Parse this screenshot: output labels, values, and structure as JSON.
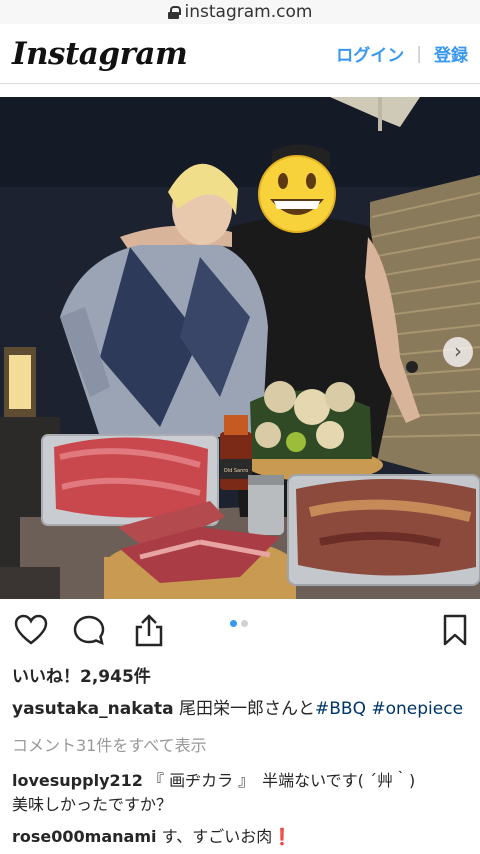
{
  "browser": {
    "url": "instagram.com"
  },
  "header": {
    "logo": "Instagram",
    "login": "ログイン",
    "signup": "登録"
  },
  "post": {
    "likes": "いいね！2,945件",
    "caption": {
      "user": "yasutaka_nakata",
      "text": "尾田栄一郎さんと",
      "tags": [
        "#BBQ",
        "#onepiece"
      ]
    },
    "view_all_comments": "コメント31件をすべて表示",
    "comments": [
      {
        "user": "lovesupply212",
        "text": "『 画ヂカラ 』　半端ないです( ´艸｀)",
        "text2": "美味しかったですか？"
      },
      {
        "user": "rose000manami",
        "text": "す、すごいお肉",
        "emoji": "❗"
      }
    ],
    "bottle_label": "Old Sanro",
    "carousel": {
      "count": 2,
      "active": 0
    }
  },
  "colors": {
    "link": "#3897f0",
    "hashtag": "#003569",
    "muted": "#999999",
    "emoji_red": "#e0262c"
  },
  "icons": [
    "lock-icon",
    "heart-icon",
    "comment-icon",
    "share-icon",
    "bookmark-icon",
    "chevron-right-icon",
    "grinning-face-emoji"
  ]
}
